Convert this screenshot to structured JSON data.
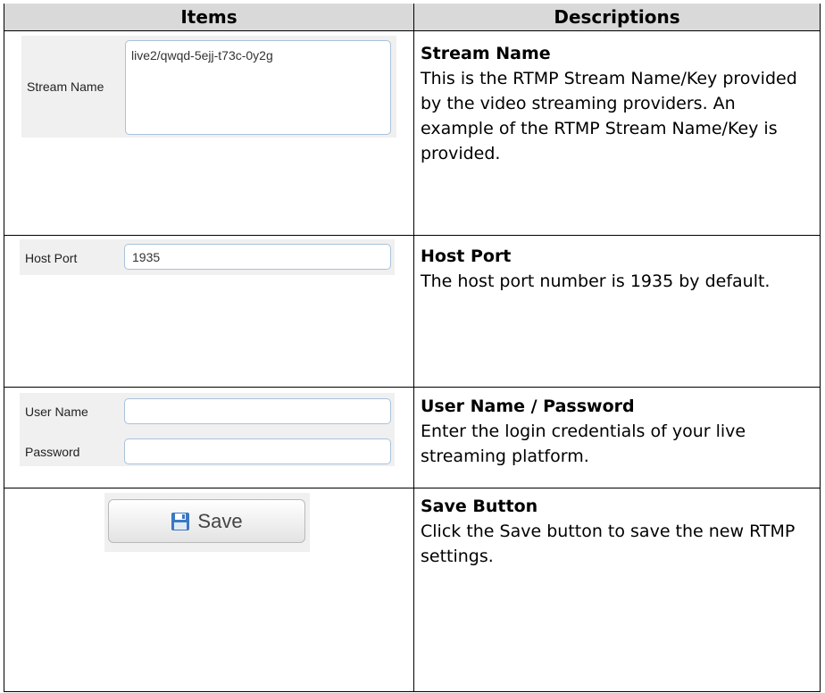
{
  "headers": {
    "items": "Items",
    "descriptions": "Descriptions"
  },
  "rows": {
    "stream_name": {
      "label": "Stream Name",
      "value": "live2/qwqd-5ejj-t73c-0y2g",
      "title": "Stream Name",
      "description": "This is the RTMP Stream Name/Key provided by the video streaming providers. An example of the RTMP Stream Name/Key is provided."
    },
    "host_port": {
      "label": "Host Port",
      "value": "1935",
      "title": "Host Port",
      "description": "The host port number is 1935 by default."
    },
    "credentials": {
      "user_label": "User Name",
      "user_value": "",
      "password_label": "Password",
      "password_value": "",
      "title": "User Name / Password",
      "description": "Enter the login credentials of your live streaming platform."
    },
    "save": {
      "button_label": "Save",
      "icon": "floppy-disk-icon",
      "title": "Save Button",
      "description": "Click the Save button to save the new RTMP settings."
    }
  },
  "colors": {
    "header_bg": "#d9d9d9",
    "panel_bg": "#f0f0f0",
    "input_border": "#a9c2dc",
    "save_icon": "#3a78c2"
  }
}
